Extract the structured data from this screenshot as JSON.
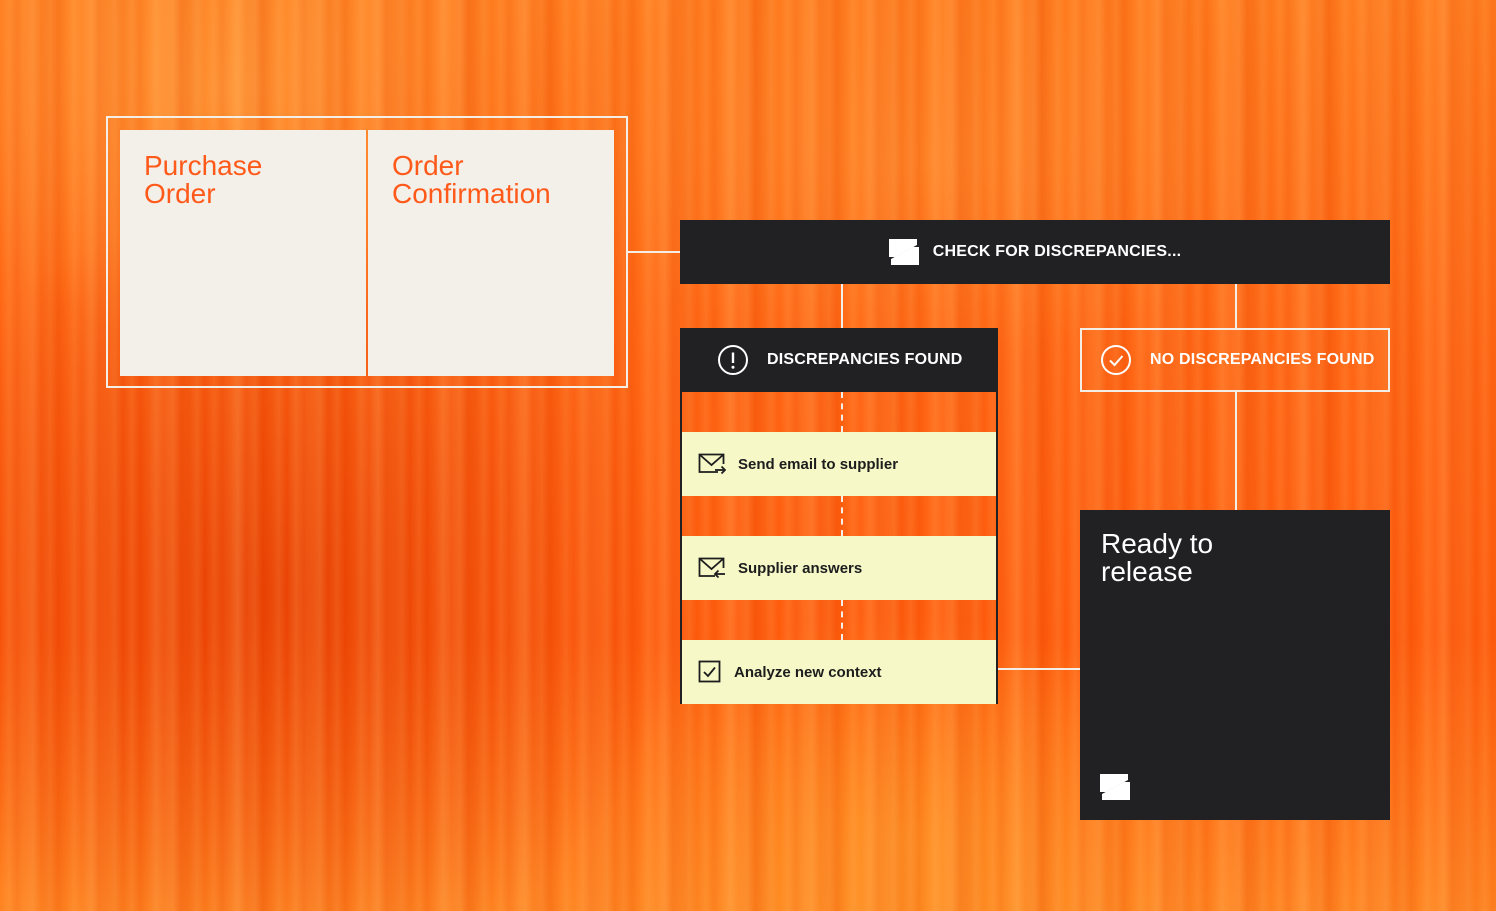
{
  "documents": {
    "purchase_order": "Purchase\nOrder",
    "order_confirmation": "Order\nConfirmation"
  },
  "check": {
    "label": "CHECK FOR DISCREPANCIES...",
    "icon": "logo-icon"
  },
  "branches": {
    "found": {
      "label": "DISCREPANCIES FOUND",
      "icon": "exclamation-circle-icon"
    },
    "not_found": {
      "label": "NO DISCREPANCIES FOUND",
      "icon": "check-circle-icon"
    }
  },
  "steps": [
    {
      "label": "Send email to supplier",
      "icon": "mail-send-icon"
    },
    {
      "label": "Supplier answers",
      "icon": "mail-reply-icon"
    },
    {
      "label": "Analyze new context",
      "icon": "checkbox-icon"
    }
  ],
  "result": {
    "label": "Ready to\nrelease",
    "icon": "logo-icon"
  },
  "colors": {
    "background": "#ff6a10",
    "dark": "#212124",
    "card": "#f3f0ea",
    "step": "#f6f8c8",
    "accent_text": "#ff5a1a",
    "line": "#f4efe6"
  }
}
